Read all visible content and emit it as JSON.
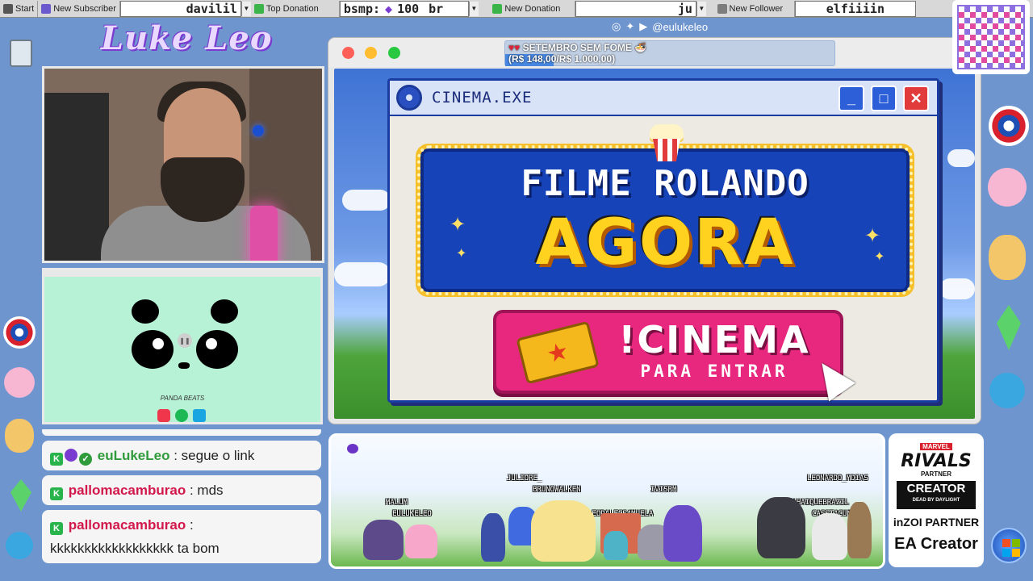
{
  "topbar": {
    "start": "Start",
    "new_subscriber_label": "New Subscriber",
    "new_subscriber_value": "davilil",
    "top_donation_label": "Top Donation",
    "top_donation_value": "bsmp:",
    "top_donation_amount": "100",
    "top_donation_currency": "br",
    "new_donation_label": "New Donation",
    "new_donation_value": "ju",
    "new_follower_label": "New Follower",
    "new_follower_value": "elfiiiin"
  },
  "logo": "Luke Leo",
  "social": {
    "handle": "@eulukeleo"
  },
  "goal": {
    "title": "SETEMBRO SEM FOME",
    "amount": "(R$ 148,00/R$ 1.000,00)",
    "progress": 0.148
  },
  "window_buttons": {
    "close": "#ff5f57",
    "minimize": "#febc2e",
    "maximize": "#28c840"
  },
  "cinema": {
    "title": "CINEMA.EXE",
    "line1": "FILME ROLANDO",
    "line2": "AGORA",
    "command": "!CINEMA",
    "hint": "PARA ENTRAR",
    "min_icon": "minimize-icon",
    "max_icon": "maximize-icon",
    "close_icon": "close-icon"
  },
  "panda": {
    "label": "PANDA BEATS",
    "apps": [
      "apple-music-icon",
      "spotify-icon",
      "amazon-music-icon"
    ]
  },
  "chat": [
    {
      "user": "euLukeLeo",
      "text": "segue o link",
      "color": "#2f9b3b"
    },
    {
      "user": "pallomacamburao",
      "text": "mds",
      "color": "#d2174b"
    },
    {
      "user": "pallomacamburao",
      "text": "kkkkkkkkkkkkkkkkkk ta bom",
      "color": "#d2174b"
    }
  ],
  "game_names": [
    "JULIORE_",
    "BRUNOWALKEN",
    "IVISRM",
    "LEONARDO_MDIAS",
    "MALUM",
    "EULUKELEO",
    "LEODALECS4MUELA",
    "EUHAIQUEBRAZIL",
    "CASSIACUNHA"
  ],
  "partners": {
    "marvel_top": "MARVEL",
    "rivals": "RIVALS",
    "rivals_sub": "PARTNER",
    "creator": "CREATOR",
    "creator_sub": "DEAD BY DAYLIGHT",
    "inzoi": "inZOI PARTNER",
    "ea": "EA Creator"
  }
}
